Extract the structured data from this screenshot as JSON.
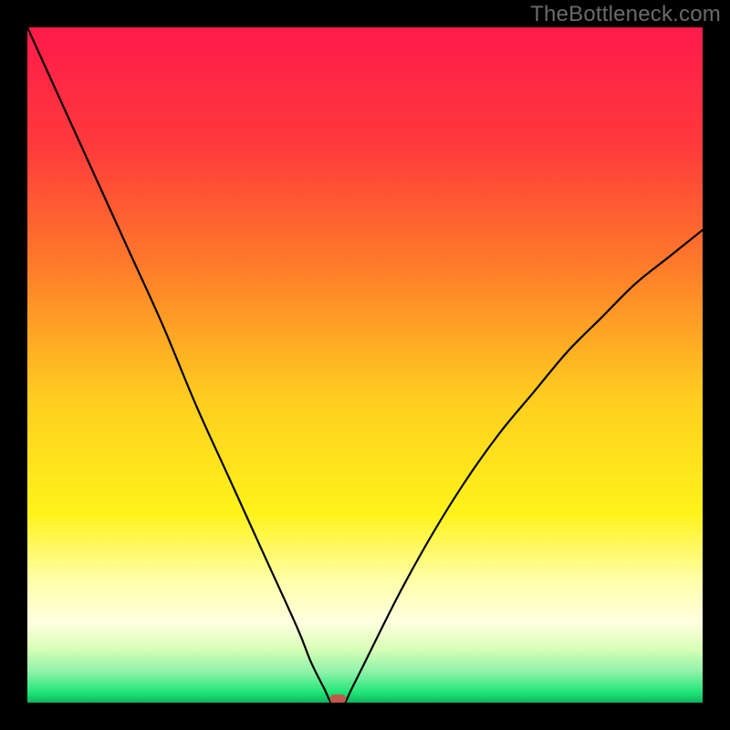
{
  "watermark": "TheBottleneck.com",
  "chart_data": {
    "type": "line",
    "title": "",
    "xlabel": "",
    "ylabel": "",
    "xlim": [
      0,
      100
    ],
    "ylim": [
      0,
      100
    ],
    "grid": false,
    "series": [
      {
        "name": "bottleneck-curve",
        "x": [
          0,
          5,
          10,
          15,
          20,
          25,
          30,
          35,
          40,
          42,
          44,
          45,
          46,
          47,
          48,
          50,
          55,
          60,
          65,
          70,
          75,
          80,
          85,
          90,
          95,
          100
        ],
        "values": [
          100,
          89,
          78,
          67,
          56,
          44,
          33,
          22,
          11,
          6,
          2,
          0,
          0,
          0,
          2,
          6,
          16,
          25,
          33,
          40,
          46,
          52,
          57,
          62,
          66,
          70
        ],
        "color": "#000000"
      }
    ],
    "minimum_marker": {
      "x": 46,
      "y": 0,
      "color": "#c05a4a"
    },
    "background_gradient": {
      "stops": [
        {
          "offset": 0.0,
          "color": "#ff1a4b"
        },
        {
          "offset": 0.18,
          "color": "#ff3b3b"
        },
        {
          "offset": 0.35,
          "color": "#ff7a2a"
        },
        {
          "offset": 0.55,
          "color": "#ffce1f"
        },
        {
          "offset": 0.72,
          "color": "#fff31a"
        },
        {
          "offset": 0.82,
          "color": "#ffffaa"
        },
        {
          "offset": 0.88,
          "color": "#ffffdf"
        },
        {
          "offset": 0.92,
          "color": "#d9ffb8"
        },
        {
          "offset": 0.955,
          "color": "#8cf2a8"
        },
        {
          "offset": 0.985,
          "color": "#1fe676"
        },
        {
          "offset": 1.0,
          "color": "#0fb45f"
        }
      ]
    }
  }
}
